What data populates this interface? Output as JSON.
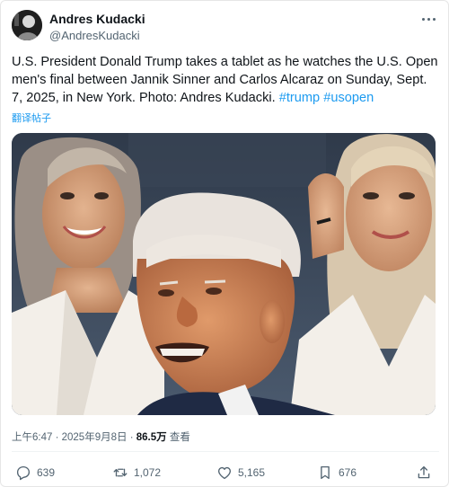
{
  "author": {
    "display_name": "Andres Kudacki",
    "handle": "@AndresKudacki"
  },
  "tweet": {
    "text": "U.S. President Donald Trump takes a tablet as he watches the U.S. Open men's final between Jannik Sinner and Carlos Alcaraz on Sunday, Sept. 7, 2025, in New York. Photo: Andres Kudacki.",
    "hashtags": [
      "#trump",
      "#usopen"
    ],
    "translate_label": "翻译帖子"
  },
  "meta": {
    "time": "上午6:47",
    "separator": " · ",
    "date": "2025年9月8日",
    "views_count": "86.5万",
    "views_label": "查看"
  },
  "actions": {
    "replies": "639",
    "reposts": "1,072",
    "likes": "5,165",
    "bookmarks": "676"
  },
  "colors": {
    "accent": "#1d9bf0",
    "secondary_text": "#536471"
  }
}
